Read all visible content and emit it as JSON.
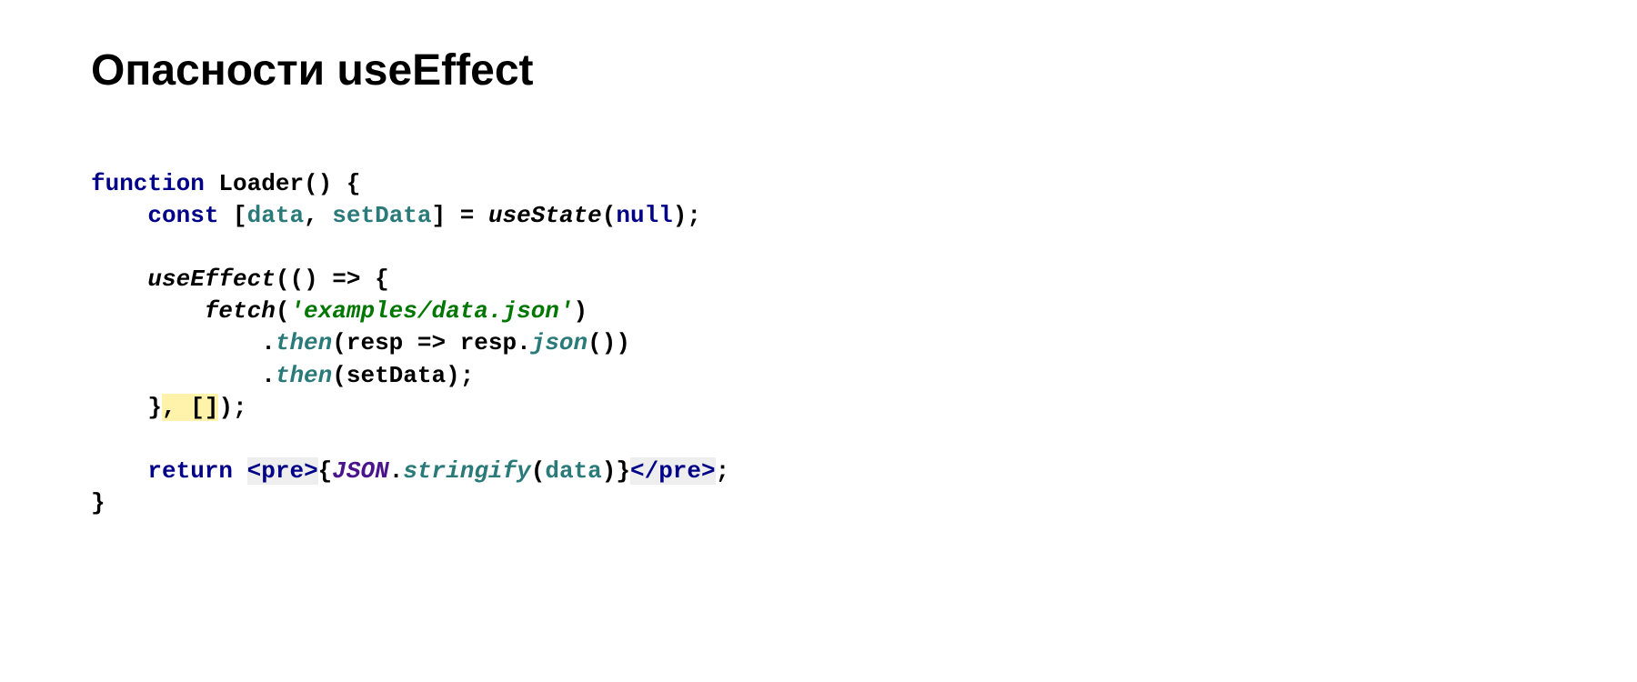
{
  "title": "Опасности useEffect",
  "code": {
    "l1_function": "function",
    "l1_name": " Loader() {",
    "l2_indent": "    ",
    "l2_const": "const",
    "l2_open": " [",
    "l2_data": "data",
    "l2_comma": ", ",
    "l2_setdata": "setData",
    "l2_close": "] = ",
    "l2_usestate": "useState",
    "l2_args": "(",
    "l2_null": "null",
    "l2_end": ");",
    "l3": "",
    "l4_indent": "    ",
    "l4_useeffect": "useEffect",
    "l4_rest": "(() => {",
    "l5_indent": "        ",
    "l5_fetch": "fetch",
    "l5_open": "(",
    "l5_str": "'examples/data.json'",
    "l5_close": ")",
    "l6_indent": "            .",
    "l6_then": "then",
    "l6_open": "(resp => resp.",
    "l6_json": "json",
    "l6_close": "())",
    "l7_indent": "            .",
    "l7_then": "then",
    "l7_rest": "(setData);",
    "l8_indent": "    }",
    "l8_hl": ", []",
    "l8_end": ");",
    "l9": "",
    "l10_indent": "    ",
    "l10_return": "return",
    "l10_sp": " ",
    "l10_tag_open": "<pre>",
    "l10_brace_open": "{",
    "l10_json": "JSON",
    "l10_dot": ".",
    "l10_stringify": "stringify",
    "l10_paren_open": "(",
    "l10_data": "data",
    "l10_paren_close": ")}",
    "l10_tag_close": "</pre>",
    "l10_semi": ";",
    "l11": "}"
  }
}
